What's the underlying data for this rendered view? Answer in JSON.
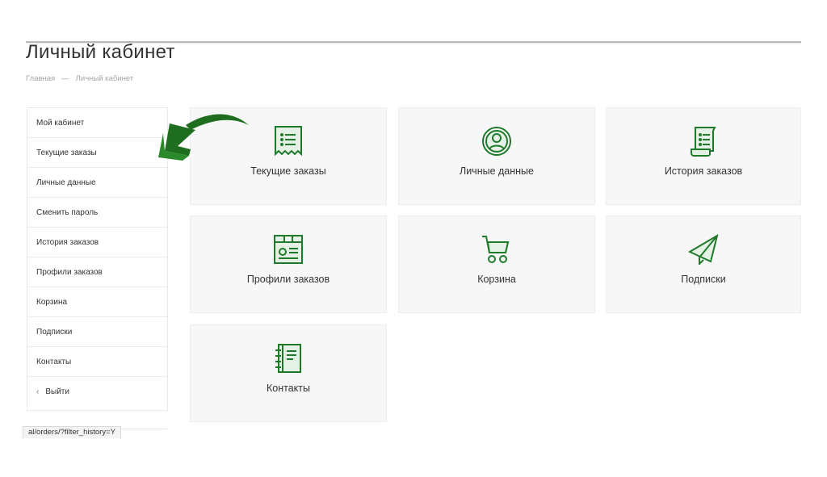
{
  "page": {
    "title": "Личный кабинет"
  },
  "breadcrumb": {
    "home": "Главная",
    "separator": "—",
    "current": "Личный кабинет"
  },
  "sidebar": {
    "items": [
      {
        "label": "Мой кабинет"
      },
      {
        "label": "Текущие заказы"
      },
      {
        "label": "Личные данные"
      },
      {
        "label": "Сменить пароль"
      },
      {
        "label": "История заказов"
      },
      {
        "label": "Профили заказов"
      },
      {
        "label": "Корзина"
      },
      {
        "label": "Подписки"
      },
      {
        "label": "Контакты"
      },
      {
        "label": "Выйти",
        "icon": "chevron-left-icon"
      }
    ]
  },
  "tiles": [
    {
      "label": "Текущие заказы",
      "icon": "receipt-icon"
    },
    {
      "label": "Личные данные",
      "icon": "user-circle-icon"
    },
    {
      "label": "История заказов",
      "icon": "scroll-icon"
    },
    {
      "label": "Профили заказов",
      "icon": "profile-card-icon"
    },
    {
      "label": "Корзина",
      "icon": "cart-icon"
    },
    {
      "label": "Подписки",
      "icon": "paper-plane-icon"
    },
    {
      "label": "Контакты",
      "icon": "notebook-icon"
    }
  ],
  "status_bar": {
    "url": "al/orders/?filter_history=Y"
  },
  "colors": {
    "accent": "#1e7a2a",
    "arrow": "#1f6e1f",
    "tile_bg": "#f7f7f7"
  }
}
